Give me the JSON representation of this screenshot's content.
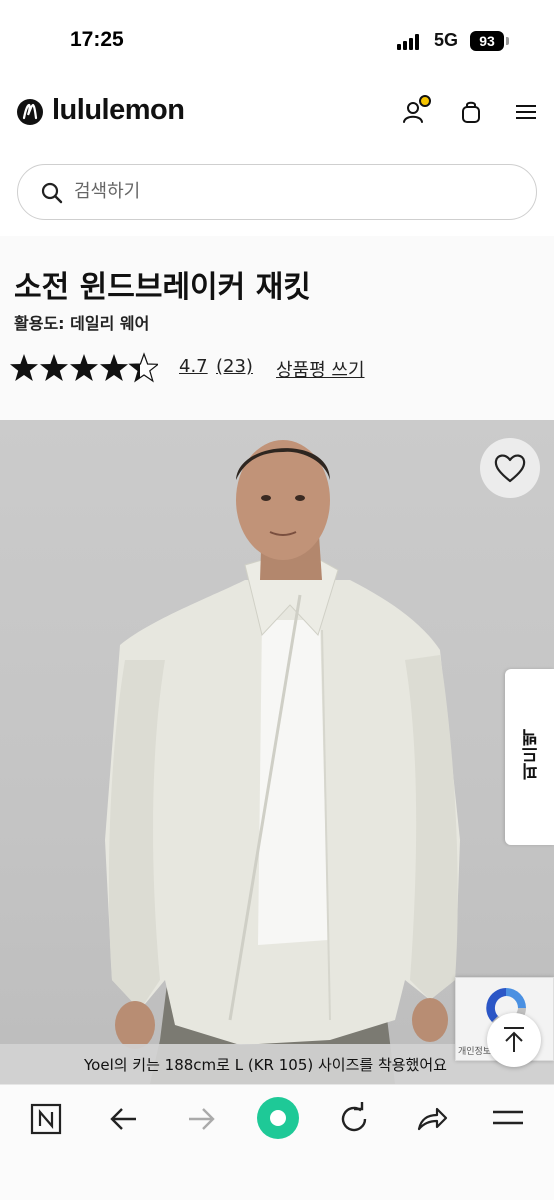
{
  "status_bar": {
    "time": "17:25",
    "network": "5G",
    "battery": "93"
  },
  "header": {
    "logo_text": "lululemon",
    "icons": [
      "account-icon",
      "shopping-bag-icon",
      "menu-icon"
    ]
  },
  "search": {
    "placeholder": "검색하기"
  },
  "product": {
    "title": "소전 윈드브레이커 재킷",
    "activity": "활용도: 데일리 웨어",
    "rating": 4.7,
    "rating_score": "4.7",
    "review_count": "(23)",
    "write_review": "상품평 쓰기"
  },
  "image": {
    "caption": "Yoel의 키는 188cm로 L (KR 105) 사이즈를 착용했어요",
    "feedback_label": "피드백",
    "recaptcha_text": "개인정보 보호 - 약관"
  },
  "toolbar": {
    "icons": [
      "naver-icon",
      "back-icon",
      "forward-icon",
      "home-icon",
      "refresh-icon",
      "share-icon",
      "menu-icon"
    ]
  },
  "colors": {
    "brand": "#111111",
    "accent_green": "#1ec997",
    "notif_yellow": "#f5c400"
  }
}
